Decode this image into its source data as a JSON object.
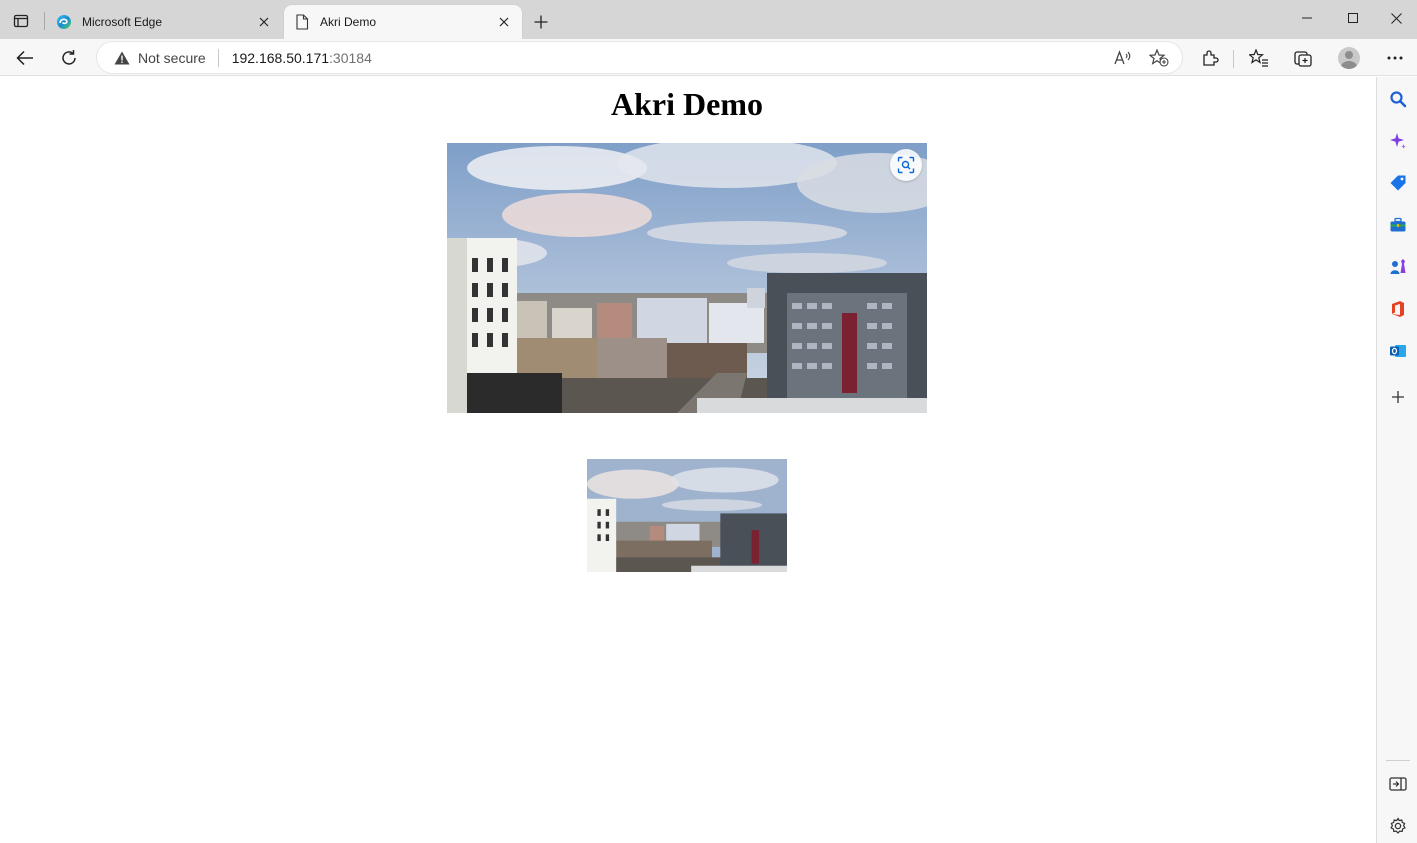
{
  "browser": {
    "tabs": [
      {
        "title": "Microsoft Edge",
        "active": false,
        "icon": "edge-logo-icon"
      },
      {
        "title": "Akri Demo",
        "active": true,
        "icon": "page-icon"
      }
    ],
    "address": {
      "security_label": "Not secure",
      "host": "192.168.50.171",
      "port": ":30184"
    },
    "accent_color": "#0a66d8"
  },
  "page": {
    "title": "Akri Demo",
    "images": [
      {
        "name": "camera-feed-main",
        "alt": "Camera feed"
      },
      {
        "name": "camera-feed-thumbnail",
        "alt": "Camera feed"
      }
    ]
  },
  "sidebar": {
    "items": [
      "search-icon",
      "copilot-icon",
      "shopping-tag-icon",
      "tools-icon",
      "games-icon",
      "office-icon",
      "outlook-icon",
      "add-icon",
      "hide-sidebar-icon",
      "settings-icon"
    ]
  }
}
